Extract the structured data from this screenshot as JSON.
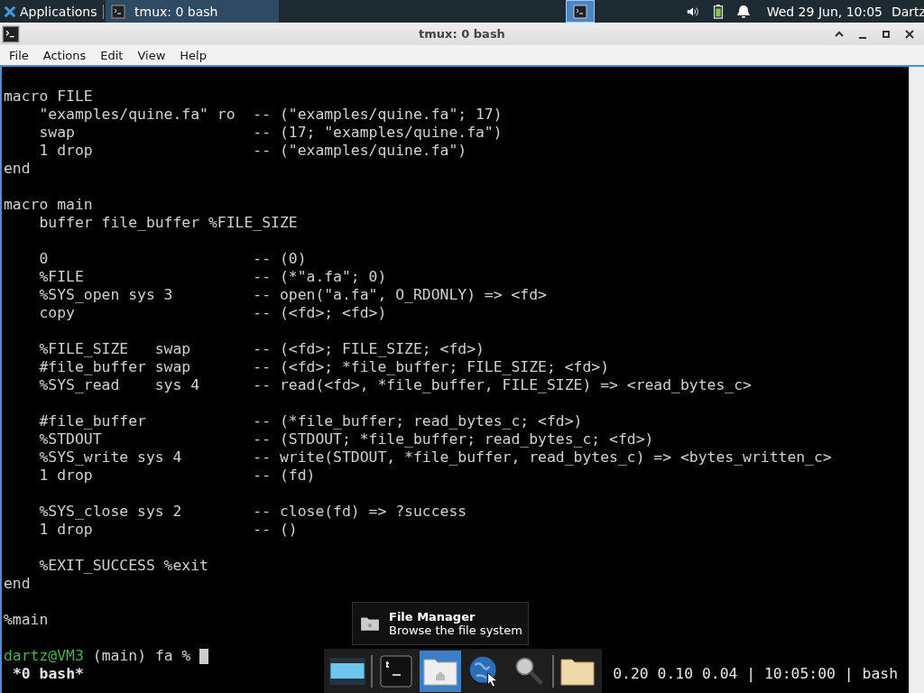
{
  "panel": {
    "applications_label": "Applications",
    "tasks": [
      {
        "label": "tmux: 0 bash",
        "selected": true
      }
    ],
    "clock": "Wed 29 Jun, 10:05",
    "user": "Dartz"
  },
  "window": {
    "title": "tmux: 0 bash"
  },
  "menu": [
    "File",
    "Actions",
    "Edit",
    "View",
    "Help"
  ],
  "terminal": {
    "blocks": [
      [
        "macro FILE",
        "    \"examples/quine.fa\" ro  -- (\"examples/quine.fa\"; 17)",
        "    swap                    -- (17; \"examples/quine.fa\")",
        "    1 drop                  -- (\"examples/quine.fa\")",
        "end"
      ],
      [
        "macro main",
        "    buffer file_buffer %FILE_SIZE"
      ],
      [
        "    0                       -- (0)",
        "    %FILE                   -- (*\"a.fa\"; 0)",
        "    %SYS_open sys 3         -- open(\"a.fa\", O_RDONLY) => <fd>",
        "    copy                    -- (<fd>; <fd>)"
      ],
      [
        "    %FILE_SIZE   swap       -- (<fd>; FILE_SIZE; <fd>)",
        "    #file_buffer swap       -- (<fd>; *file_buffer; FILE_SIZE; <fd>)",
        "    %SYS_read    sys 4      -- read(<fd>, *file_buffer, FILE_SIZE) => <read_bytes_c>"
      ],
      [
        "    #file_buffer            -- (*file_buffer; read_bytes_c; <fd>)",
        "    %STDOUT                 -- (STDOUT; *file_buffer; read_bytes_c; <fd>)",
        "    %SYS_write sys 4        -- write(STDOUT, *file_buffer, read_bytes_c) => <bytes_written_c>",
        "    1 drop                  -- (fd)"
      ],
      [
        "    %SYS_close sys 2        -- close(fd) => ?success",
        "    1 drop                  -- ()"
      ],
      [
        "    %EXIT_SUCCESS %exit",
        "end"
      ],
      [
        "%main"
      ]
    ],
    "prompt": {
      "user_host": "dartz@VM3",
      "rest": "(main) fa %"
    },
    "status_left": "*0 bash*",
    "status_right": "0.20 0.10 0.04 | 10:05:00 | bash"
  },
  "tooltip": {
    "title": "File Manager",
    "subtitle": "Browse the file system"
  },
  "dock": [
    {
      "kind": "desktop",
      "selected": false
    },
    {
      "kind": "terminal",
      "selected": false
    },
    {
      "kind": "home",
      "selected": true
    },
    {
      "kind": "globe",
      "selected": false
    },
    {
      "kind": "search",
      "selected": false
    },
    {
      "kind": "folder",
      "selected": false
    }
  ]
}
